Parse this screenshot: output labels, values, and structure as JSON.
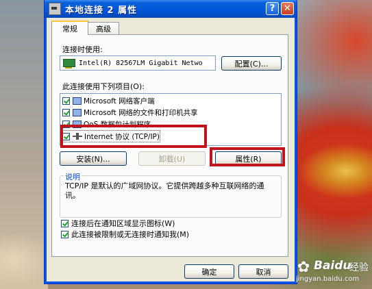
{
  "window": {
    "title": "本地连接 2 属性",
    "help_glyph": "?",
    "close_glyph": "✕"
  },
  "tabs": [
    {
      "label": "常规",
      "active": true
    },
    {
      "label": "高级",
      "active": false
    }
  ],
  "connect_using": {
    "label": "连接时使用:",
    "adapter": "Intel(R) 82567LM Gigabit Netwo",
    "configure_button": "配置(C)..."
  },
  "components": {
    "label": "此连接使用下列项目(O):",
    "items": [
      {
        "text": "Microsoft 网络客户端",
        "checked": true
      },
      {
        "text": "Microsoft 网络的文件和打印机共享",
        "checked": true
      },
      {
        "text": "QoS 数据包计划程序",
        "checked": true
      },
      {
        "text": "Internet 协议 (TCP/IP)",
        "checked": true,
        "selected": true
      }
    ]
  },
  "buttons": {
    "install": "安装(N)...",
    "uninstall": "卸载(U)",
    "properties": "属性(R)"
  },
  "description": {
    "legend": "说明",
    "text": "TCP/IP 是默认的广域网协议。它提供跨越多种互联网络的通讯。"
  },
  "options": [
    {
      "label": "连接后在通知区域显示图标(W)",
      "checked": true
    },
    {
      "label": "此连接被限制或无连接时通知我(M)",
      "checked": true
    }
  ],
  "footer": {
    "ok": "确定",
    "cancel": "取消"
  },
  "watermark": {
    "brand": "Baidu",
    "suffix": "经验",
    "url": "jingyan.baidu.com"
  },
  "colors": {
    "highlight_red": "#c2121c",
    "title_blue": "#0056d6",
    "legend_blue": "#0046d5"
  }
}
